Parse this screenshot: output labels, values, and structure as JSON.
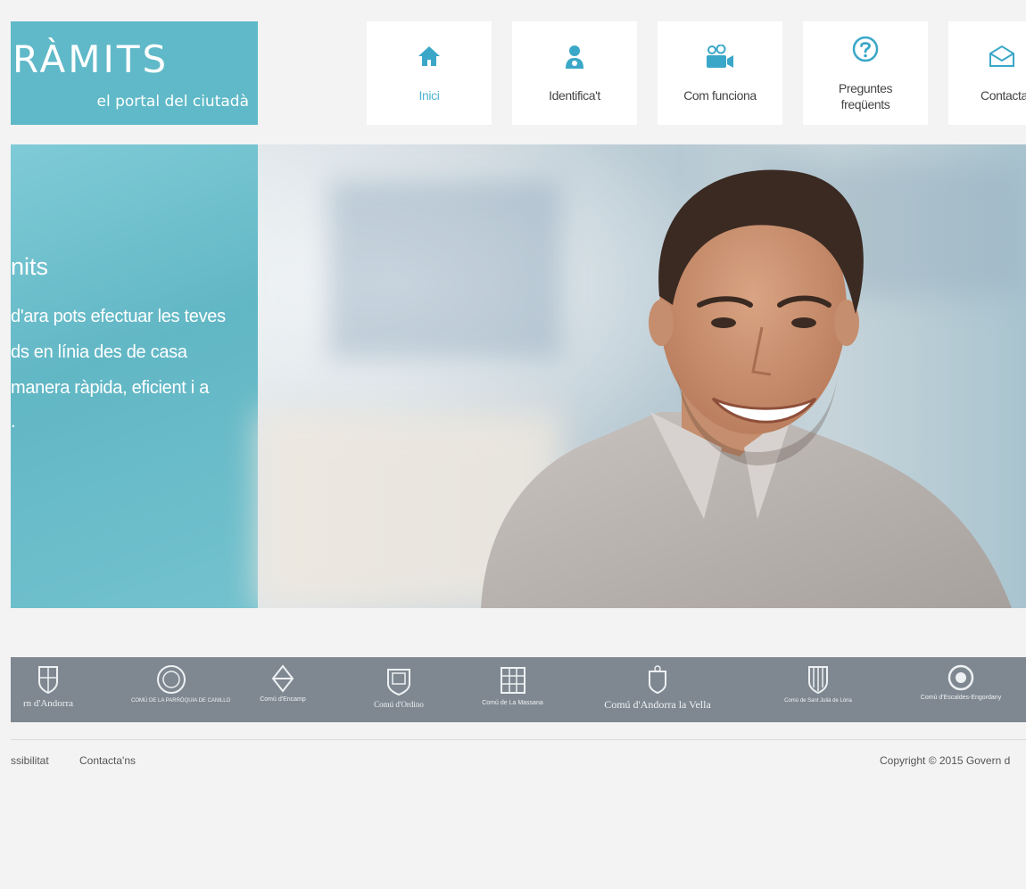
{
  "logo": {
    "brand": "RÀMITS",
    "tagline": "el portal del ciutadà"
  },
  "nav": [
    {
      "label": "Inici",
      "icon": "home-icon"
    },
    {
      "label": "Identifica't",
      "icon": "user-icon"
    },
    {
      "label": "Com funciona",
      "icon": "video-camera-icon"
    },
    {
      "label": "Preguntes frequënts",
      "label_line1": "Preguntes",
      "label_line2": "freqüents",
      "icon": "question-icon"
    },
    {
      "label": "Contacta",
      "icon": "envelope-icon"
    }
  ],
  "hero": {
    "title": "nits",
    "lines": [
      "d'ara pots efectuar les teves",
      "ds en línia des de casa",
      "manera ràpida, eficient i a",
      "."
    ]
  },
  "logos": [
    {
      "caption": "rn d'Andorra"
    },
    {
      "caption": "COMÚ DE LA PARRÒQUIA DE CANILLO"
    },
    {
      "caption": "Comú d'Encamp"
    },
    {
      "caption": "Comú d'Ordino"
    },
    {
      "caption": "Comú de La Massana"
    },
    {
      "caption": "Comú d'Andorra la Vella"
    },
    {
      "caption": "Comú de Sant Julià de Lòria"
    },
    {
      "caption": "Comú d'Escaldes-Engordany"
    }
  ],
  "footer": {
    "accessibility": "ssibilitat",
    "contact": "Contacta'ns",
    "copyright": "Copyright © 2015 Govern d"
  },
  "colors": {
    "accent": "#5fb9c8",
    "active_nav": "#4fb3cf",
    "logos_bar": "#7f8891"
  }
}
